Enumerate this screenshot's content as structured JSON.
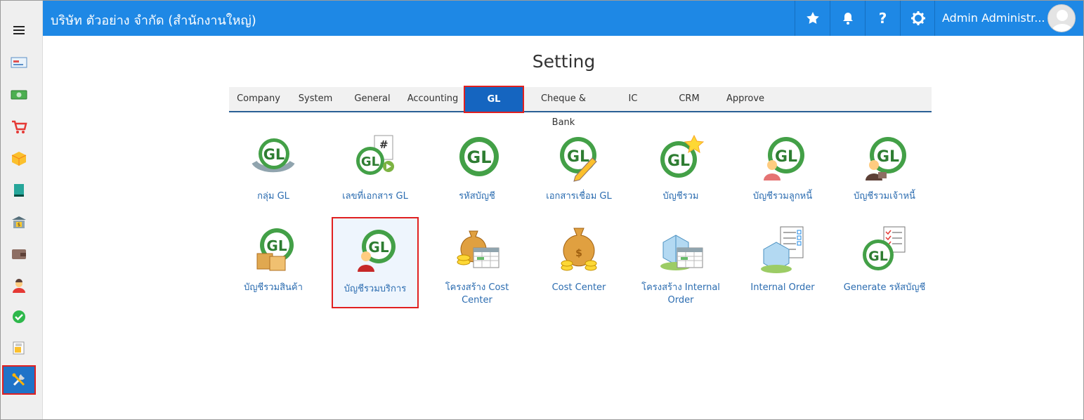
{
  "company_name": "บริษัท ตัวอย่าง จำกัด (สำนักงานใหญ่)",
  "user_name": "Admin Administr...",
  "page_title": "Setting",
  "tabs": [
    {
      "label": "Company"
    },
    {
      "label": "System"
    },
    {
      "label": "General"
    },
    {
      "label": "Accounting"
    },
    {
      "label": "GL",
      "active": true
    },
    {
      "label": "Cheque & Bank"
    },
    {
      "label": "IC"
    },
    {
      "label": "CRM"
    },
    {
      "label": "Approve"
    }
  ],
  "tiles": [
    {
      "label": "กลุ่ม GL",
      "icon": "gl-group-icon"
    },
    {
      "label": "เลขที่เอกสาร GL",
      "icon": "gl-doc-number-icon"
    },
    {
      "label": "รหัสบัญชี",
      "icon": "gl-icon"
    },
    {
      "label": "เอกสารเชื่อม GL",
      "icon": "gl-link-doc-icon"
    },
    {
      "label": "บัญชีรวม",
      "icon": "gl-star-icon"
    },
    {
      "label": "บัญชีรวมลูกหนี้",
      "icon": "gl-debtor-icon"
    },
    {
      "label": "บัญชีรวมเจ้าหนี้",
      "icon": "gl-creditor-icon"
    },
    {
      "label": "บัญชีรวมสินค้า",
      "icon": "gl-product-icon"
    },
    {
      "label": "บัญชีรวมบริการ",
      "icon": "gl-service-icon",
      "selected": true
    },
    {
      "label": "โครงสร้าง Cost Center",
      "icon": "cost-structure-icon"
    },
    {
      "label": "Cost Center",
      "icon": "money-bag-icon"
    },
    {
      "label": "โครงสร้าง Internal Order",
      "icon": "internal-structure-icon"
    },
    {
      "label": "Internal Order",
      "icon": "building-checklist-icon"
    },
    {
      "label": "Generate รหัสบัญชี",
      "icon": "gl-checklist-icon"
    }
  ],
  "colors": {
    "topbar": "#1e88e5",
    "active_tab": "#1565c0",
    "highlight": "#e02020",
    "link": "#2b6cb0"
  }
}
